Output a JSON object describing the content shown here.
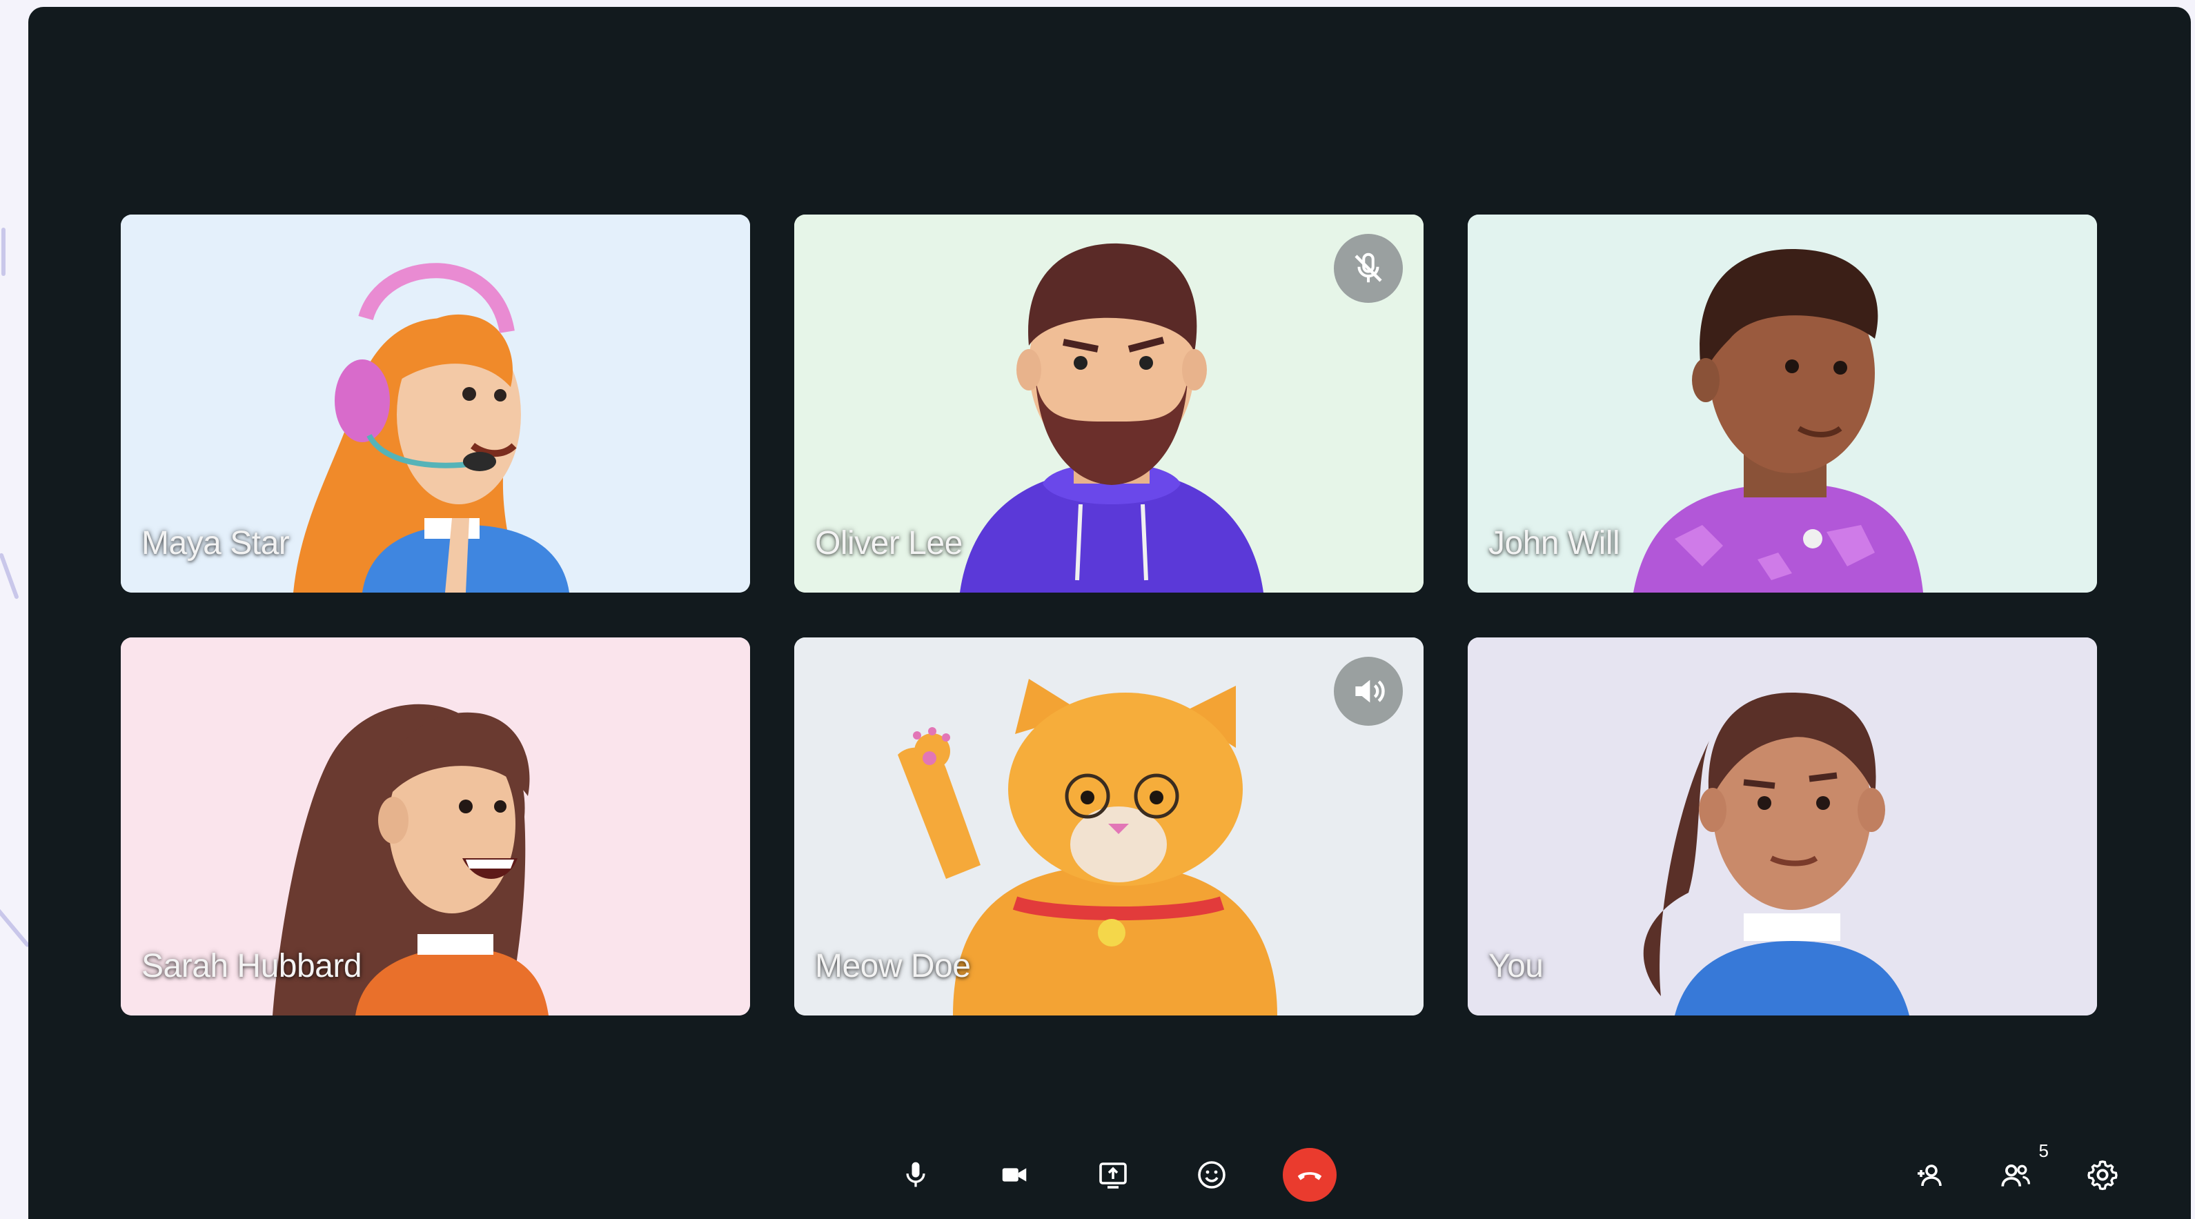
{
  "participants": [
    {
      "name": "Maya Star",
      "bg": "#e4f0fb"
    },
    {
      "name": "Oliver Lee",
      "bg": "#e6f5e8",
      "indicator": "muted-mic-icon"
    },
    {
      "name": "John Will",
      "bg": "#e2f3ef"
    },
    {
      "name": "Sarah Hubbard",
      "bg": "#fae4ec"
    },
    {
      "name": "Meow Doe",
      "bg": "#e9edf1",
      "indicator": "speaker-icon"
    },
    {
      "name": "You",
      "bg": "#e6e4f1"
    }
  ],
  "controls": {
    "center": [
      "microphone-icon",
      "camera-icon",
      "share-screen-icon",
      "emoji-icon",
      "end-call-icon"
    ],
    "right": [
      "add-person-icon",
      "participants-icon",
      "settings-icon"
    ],
    "participant_count": "5"
  },
  "colors": {
    "window_bg": "#121a1e",
    "end_call": "#ea3b2e",
    "indicator_bg": "#9aa0a0"
  }
}
